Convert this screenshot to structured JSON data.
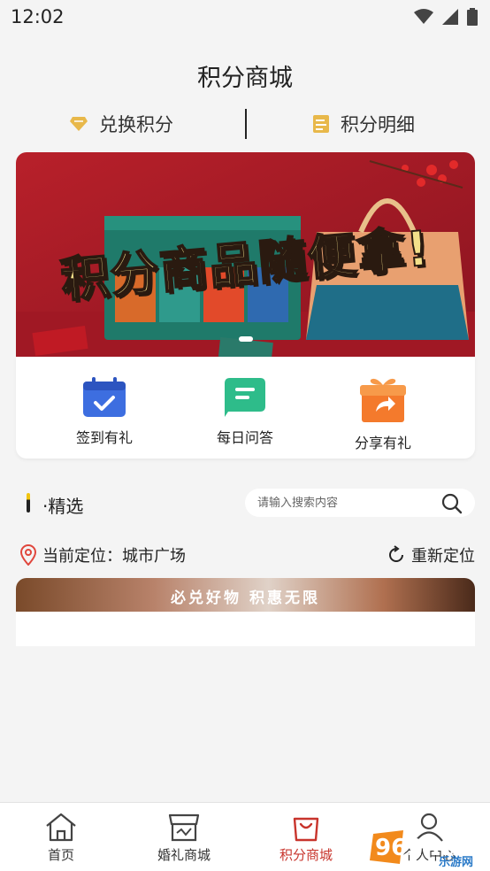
{
  "status_bar": {
    "time": "12:02"
  },
  "header": {
    "title": "积分商城"
  },
  "top_tabs": [
    {
      "label": "兑换积分",
      "icon": "diamond-icon"
    },
    {
      "label": "积分明细",
      "icon": "document-icon"
    }
  ],
  "banner": {
    "headline": "积分商品随便拿!"
  },
  "quick_actions": [
    {
      "label": "签到有礼",
      "icon": "calendar-check-icon",
      "color": "#3d6ee0"
    },
    {
      "label": "每日问答",
      "icon": "chat-icon",
      "color": "#2ebc8a"
    },
    {
      "label": "分享有礼",
      "icon": "gift-share-icon",
      "color": "#f47a2c"
    }
  ],
  "section": {
    "title": "·精选"
  },
  "search": {
    "placeholder": "请输入搜索内容"
  },
  "location": {
    "current": "当前定位：城市广场",
    "relocate": "重新定位"
  },
  "promo": {
    "text": "必兑好物 积惠无限"
  },
  "bottom_nav": [
    {
      "label": "首页",
      "icon": "home-icon",
      "active": false
    },
    {
      "label": "婚礼商城",
      "icon": "store-icon",
      "active": false
    },
    {
      "label": "积分商城",
      "icon": "shopping-bag-icon",
      "active": true
    },
    {
      "label": "个人中心",
      "icon": "user-icon",
      "active": false
    }
  ],
  "watermark": {
    "text": "962.NET",
    "subtext": "乐游网"
  },
  "colors": {
    "accent": "#c8342c",
    "background": "#f4f4f4"
  }
}
